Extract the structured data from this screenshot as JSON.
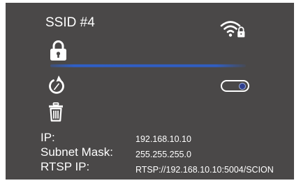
{
  "ssid": {
    "title": "SSID #4"
  },
  "icons": {
    "wifi": "wifi-lock-icon",
    "lock": "lock-icon",
    "refresh": "refresh-icon",
    "delete": "trash-icon"
  },
  "toggle": {
    "state": "on"
  },
  "colors": {
    "panel_background": "#4a4848",
    "signal_bar": "#2f5fc8",
    "toggle_knob": "#2f3f8f",
    "text": "#ffffff"
  },
  "info": {
    "ip_label": "IP:",
    "ip_value": "192.168.10.10",
    "subnet_label": "Subnet Mask:",
    "subnet_value": "255.255.255.0",
    "rtsp_label": "RTSP IP:",
    "rtsp_value": "RTSP://192.168.10.10:5004/SCION"
  }
}
